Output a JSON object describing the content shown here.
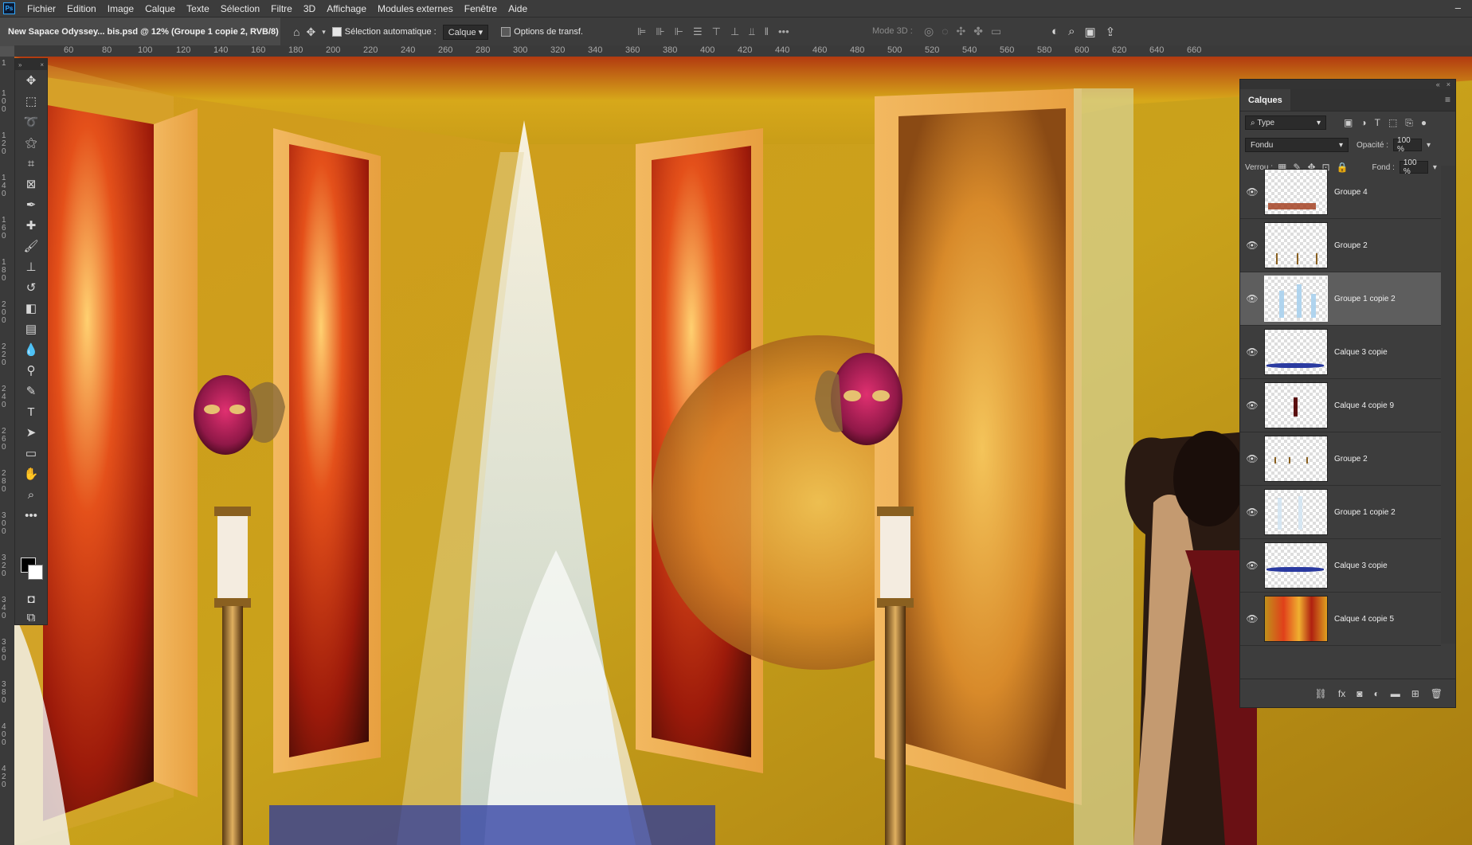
{
  "menu": {
    "logo": "Ps",
    "items": [
      "Fichier",
      "Edition",
      "Image",
      "Calque",
      "Texte",
      "Sélection",
      "Filtre",
      "3D",
      "Affichage",
      "Modules externes",
      "Fenêtre",
      "Aide"
    ]
  },
  "document_tab": "New Sapace Odyssey... bis.psd @ 12% (Groupe 1 copie 2, RVB/8) *",
  "options": {
    "auto_select_label": "Sélection automatique :",
    "auto_select_value": "Calque",
    "transform_label": "Options de transf.",
    "mode3d_label": "Mode 3D :"
  },
  "ruler": {
    "top": [
      "60",
      "80",
      "100",
      "120",
      "140",
      "160",
      "180",
      "200",
      "220",
      "240",
      "260",
      "280",
      "300",
      "320",
      "340",
      "360",
      "380",
      "400",
      "420",
      "440",
      "460",
      "480",
      "500",
      "520",
      "540",
      "560",
      "580",
      "600",
      "620",
      "640",
      "660"
    ],
    "left": [
      "1",
      "1 0 0",
      "1 2 0",
      "1 4 0",
      "1 6 0",
      "1 8 0",
      "2 0 0",
      "2 2 0",
      "2 4 0",
      "2 6 0",
      "2 8 0",
      "3 0 0",
      "3 2 0",
      "3 4 0",
      "3 6 0",
      "3 8 0",
      "4 0 0",
      "4 2 0"
    ]
  },
  "tools": [
    "move-tool",
    "marquee-tool",
    "lasso-tool",
    "magic-wand-tool",
    "crop-tool",
    "frame-tool",
    "eyedropper-tool",
    "healing-tool",
    "brush-tool",
    "stamp-tool",
    "history-brush-tool",
    "eraser-tool",
    "gradient-tool",
    "blur-tool",
    "dodge-tool",
    "pen-tool",
    "type-tool",
    "path-select-tool",
    "rectangle-tool",
    "hand-tool",
    "zoom-tool",
    "more-tools"
  ],
  "colors": {
    "foreground": "#000000",
    "background": "#ffffff",
    "panel": "#3d3d3d",
    "ui": "#3c3c3c"
  },
  "layers_panel": {
    "tab": "Calques",
    "filter_kind": "Type",
    "blend_mode": "Fondu",
    "opacity_label": "Opacité :",
    "opacity_value": "100 %",
    "lock_label": "Verrou :",
    "fill_label": "Fond :",
    "fill_value": "100 %",
    "layers": [
      {
        "name": "Groupe 4",
        "selected": false
      },
      {
        "name": "Groupe 2",
        "selected": false
      },
      {
        "name": "Groupe 1 copie 2",
        "selected": true
      },
      {
        "name": "Calque 3 copie",
        "selected": false
      },
      {
        "name": "Calque 4 copie 9",
        "selected": false
      },
      {
        "name": "Groupe 2",
        "selected": false
      },
      {
        "name": "Groupe 1 copie 2",
        "selected": false
      },
      {
        "name": "Calque 3 copie",
        "selected": false
      },
      {
        "name": "Calque 4 copie 5",
        "selected": false
      }
    ]
  }
}
